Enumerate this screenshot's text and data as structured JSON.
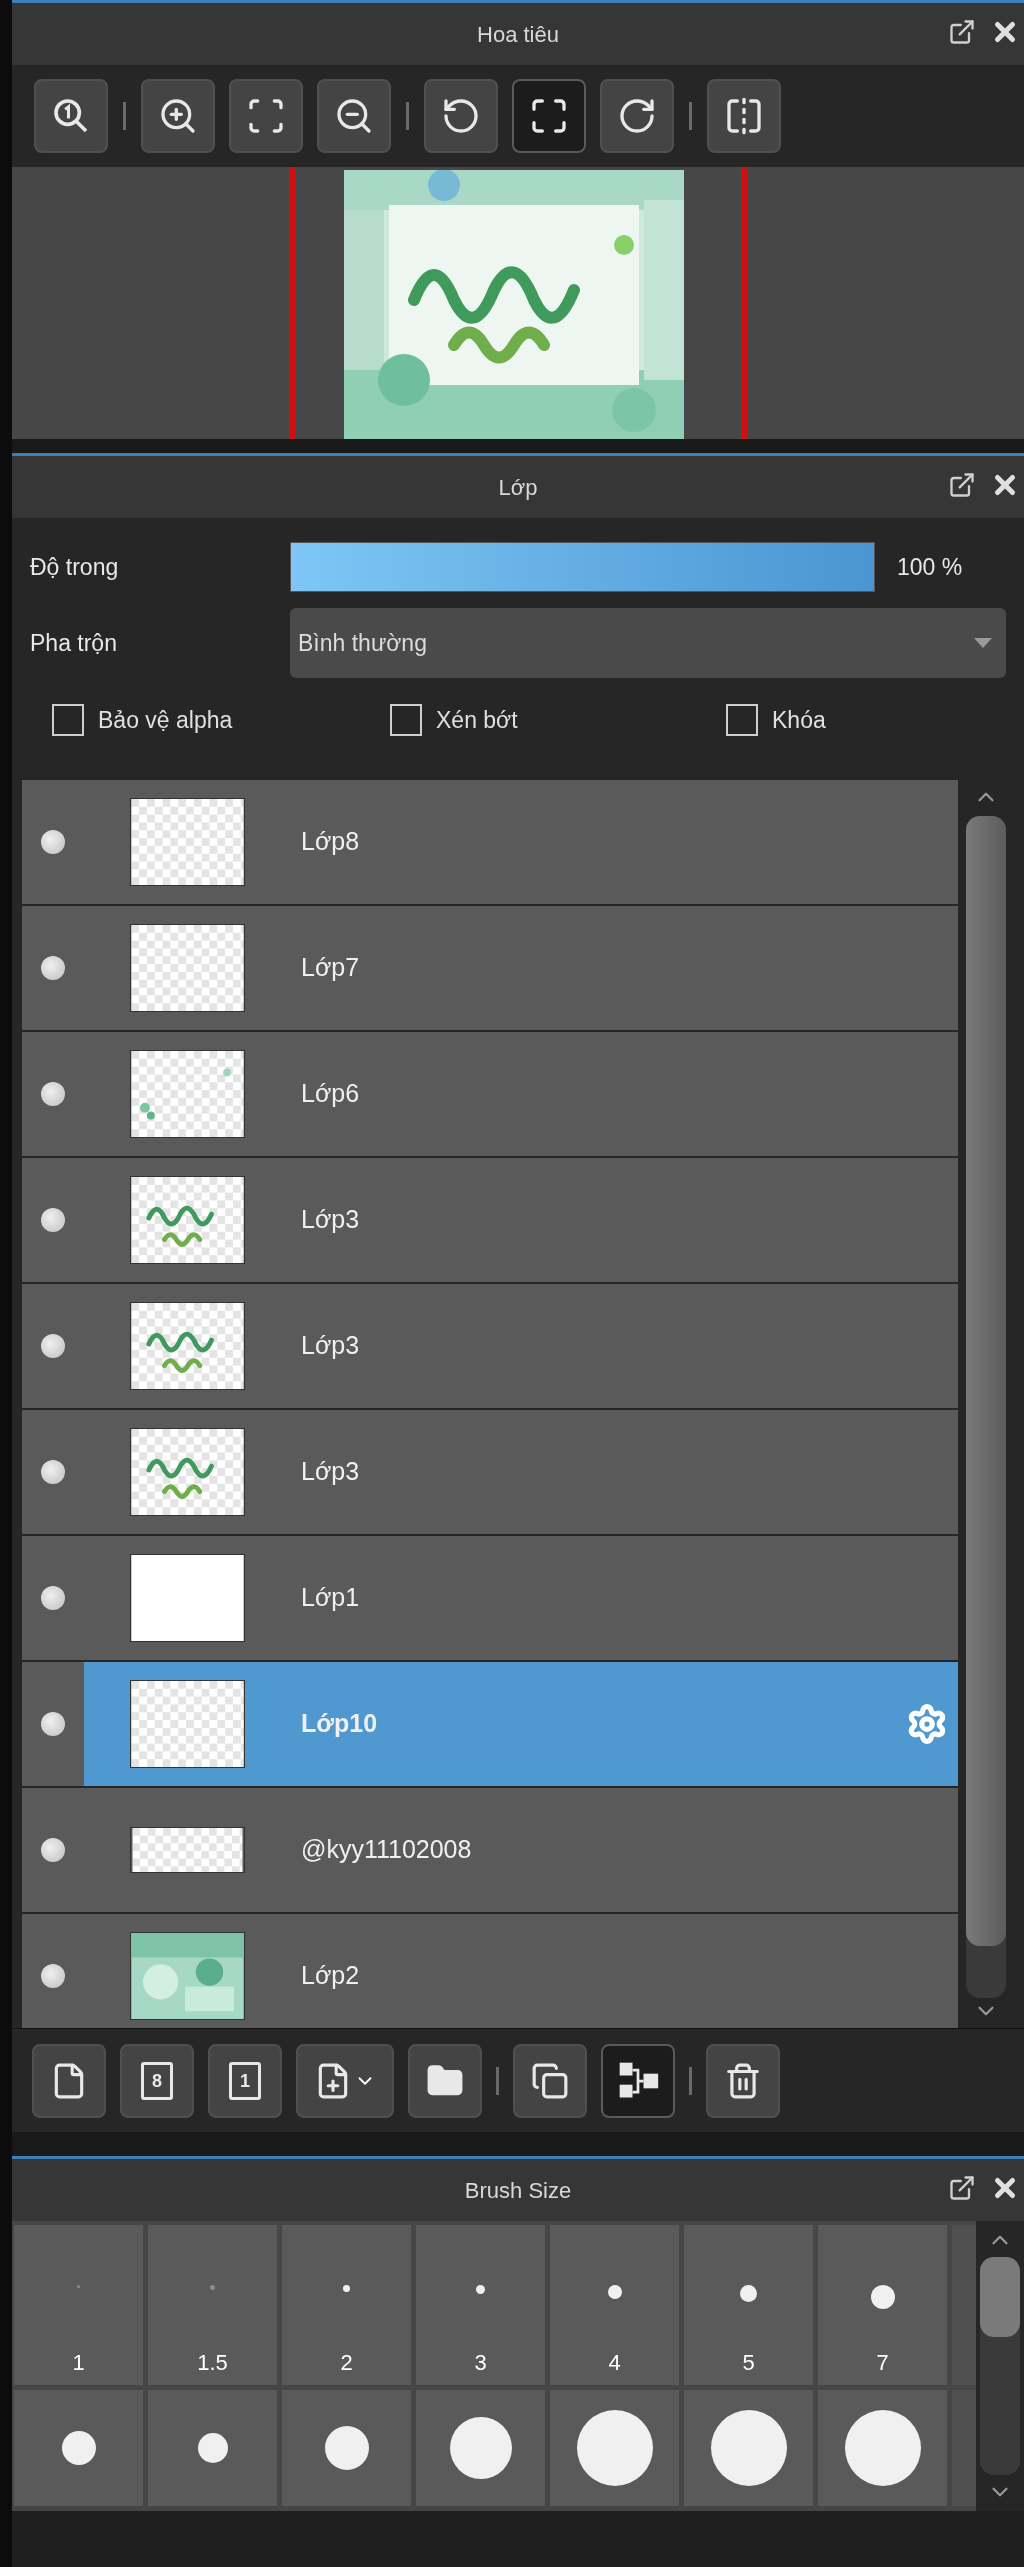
{
  "navigator": {
    "title": "Hoa tiêu",
    "toolbar": [
      {
        "kind": "zoom-reset",
        "pressed": false
      },
      {
        "kind": "separator"
      },
      {
        "kind": "zoom-in",
        "pressed": false
      },
      {
        "kind": "fit",
        "pressed": false
      },
      {
        "kind": "zoom-out",
        "pressed": false
      },
      {
        "kind": "separator"
      },
      {
        "kind": "rotate-left",
        "pressed": false
      },
      {
        "kind": "fullscreen",
        "pressed": true
      },
      {
        "kind": "rotate-right",
        "pressed": false
      },
      {
        "kind": "separator"
      },
      {
        "kind": "flip",
        "pressed": false
      }
    ]
  },
  "layers": {
    "title": "Lớp",
    "opacity": {
      "label": "Độ trong",
      "level": 1,
      "reading": "100 %"
    },
    "blend": {
      "label": "Pha trộn",
      "value": "Bình thường"
    },
    "options": [
      {
        "label": "Bảo vệ alpha",
        "checked": false
      },
      {
        "label": "Xén bớt",
        "checked": false
      },
      {
        "label": "Khóa",
        "checked": false
      }
    ],
    "items": [
      {
        "name": "Lớp8",
        "thumb": {
          "kind": "empty"
        },
        "visible": true,
        "selected": false
      },
      {
        "name": "Lớp7",
        "thumb": {
          "kind": "empty"
        },
        "visible": true,
        "selected": false
      },
      {
        "name": "Lớp6",
        "thumb": {
          "kind": "sparse"
        },
        "visible": true,
        "selected": false
      },
      {
        "name": "Lớp3",
        "thumb": {
          "kind": "text"
        },
        "visible": true,
        "selected": false
      },
      {
        "name": "Lớp3",
        "thumb": {
          "kind": "text"
        },
        "visible": true,
        "selected": false
      },
      {
        "name": "Lớp3",
        "thumb": {
          "kind": "text"
        },
        "visible": true,
        "selected": false
      },
      {
        "name": "Lớp1",
        "thumb": {
          "kind": "white"
        },
        "visible": true,
        "selected": false
      },
      {
        "name": "Lớp10",
        "thumb": {
          "kind": "empty"
        },
        "visible": true,
        "selected": true
      },
      {
        "name": "@kyy11102008",
        "thumb": {
          "kind": "wide"
        },
        "visible": true,
        "selected": false
      },
      {
        "name": "Lớp2",
        "visible": true,
        "selected": false
      }
    ],
    "toolbar": [
      {
        "kind": "new-layer",
        "pressed": false
      },
      {
        "kind": "new-layer-numbered",
        "label": "8",
        "pressed": false
      },
      {
        "kind": "new-layer-numbered",
        "label": "1",
        "pressed": false
      },
      {
        "kind": "add-menu",
        "pressed": false
      },
      {
        "kind": "folder",
        "pressed": false
      },
      {
        "kind": "separator"
      },
      {
        "kind": "duplicate",
        "pressed": false
      },
      {
        "kind": "merge",
        "pressed": true
      },
      {
        "kind": "separator"
      },
      {
        "kind": "delete",
        "pressed": false
      }
    ]
  },
  "brush_size": {
    "title": "Brush Size",
    "sizes": [
      "1",
      "1.5",
      "2",
      "3",
      "4",
      "5",
      "7"
    ]
  }
}
